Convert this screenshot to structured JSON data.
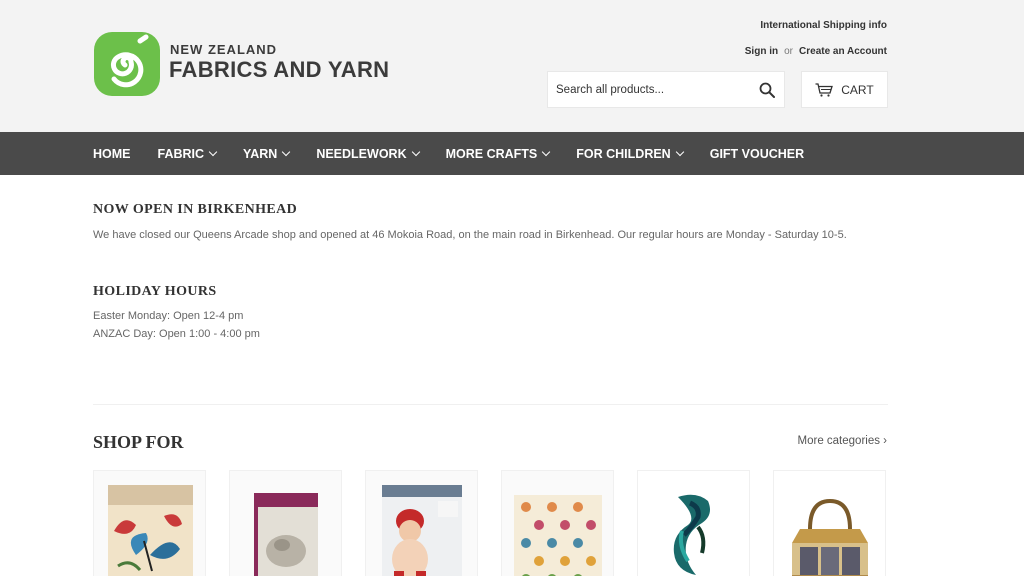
{
  "brand": {
    "line1": "NEW ZEALAND",
    "line2": "FABRICS AND YARN",
    "green": "#6cc04a"
  },
  "utility": {
    "shipping": "International Shipping info",
    "signin": "Sign in",
    "or": "or",
    "create": "Create an Account"
  },
  "search": {
    "placeholder": "Search all products..."
  },
  "cart": {
    "label": "CART"
  },
  "nav": {
    "items": [
      {
        "label": "HOME",
        "dropdown": false
      },
      {
        "label": "FABRIC",
        "dropdown": true
      },
      {
        "label": "YARN",
        "dropdown": true
      },
      {
        "label": "NEEDLEWORK",
        "dropdown": true
      },
      {
        "label": "MORE CRAFTS",
        "dropdown": true
      },
      {
        "label": "FOR CHILDREN",
        "dropdown": true
      },
      {
        "label": "GIFT VOUCHER",
        "dropdown": false
      }
    ]
  },
  "notices": {
    "birkenhead": {
      "title": "NOW OPEN IN BIRKENHEAD",
      "body": "We have closed our Queens Arcade shop and opened at 46 Mokoia Road, on the main road in Birkenhead. Our regular hours are Monday - Saturday 10-5."
    },
    "holiday": {
      "title": "HOLIDAY HOURS",
      "lines": [
        "Easter Monday: Open 12-4 pm",
        "ANZAC Day: Open 1:00 - 4:00 pm"
      ]
    }
  },
  "shop": {
    "title": "SHOP FOR",
    "more": "More categories ›",
    "categories": [
      {
        "icon": "butterfly-magazine-image"
      },
      {
        "icon": "pattern-book-image"
      },
      {
        "icon": "baby-knitwear-image"
      },
      {
        "icon": "owl-fabric-image"
      },
      {
        "icon": "hand-dyed-yarn-image"
      },
      {
        "icon": "tote-bag-image"
      }
    ]
  }
}
